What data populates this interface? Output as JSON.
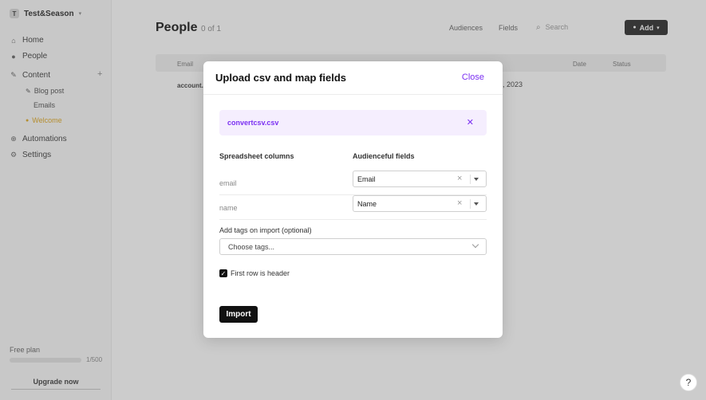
{
  "sidebar": {
    "workspace": {
      "badge": "T",
      "name": "Test&Season"
    },
    "items": [
      {
        "label": "Home",
        "icon": "home-icon"
      },
      {
        "label": "People",
        "icon": "person-icon"
      },
      {
        "label": "Content",
        "icon": "content-icon"
      },
      {
        "label": "Automations",
        "icon": "automation-icon"
      },
      {
        "label": "Settings",
        "icon": "gear-icon"
      }
    ],
    "content_sub": [
      "Blog post",
      "Emails",
      "Welcome"
    ],
    "add_glyph": "+",
    "plan_label": "Free plan",
    "plan_count": "1/500",
    "upgrade_label": "Upgrade now"
  },
  "main": {
    "title": "People",
    "count": "0 of 1",
    "links": [
      "Audiences",
      "Fields"
    ],
    "search_placeholder": "Search",
    "add_label": "Add",
    "table_headers": [
      "Email",
      "Date",
      "Status"
    ],
    "row_email": "account...",
    "row_date": ", 2023"
  },
  "modal": {
    "title": "Upload csv and map fields",
    "close_label": "Close",
    "file_name": "convertcsv.csv",
    "remove_glyph": "✕",
    "col_spreadsheet": "Spreadsheet columns",
    "col_fields": "Audienceful fields",
    "rows": [
      {
        "column": "email",
        "field": "Email"
      },
      {
        "column": "name",
        "field": "Name"
      }
    ],
    "clear_glyph": "×",
    "tags_label": "Add tags on import (optional)",
    "tags_placeholder": "Choose tags...",
    "checkbox_glyph": "✓",
    "checkbox_label": "First row is header",
    "import_label": "Import"
  },
  "help_label": "?",
  "colors": {
    "accent": "#7b2ff2",
    "file_bg": "#f5eefe",
    "primary_button": "#111111"
  }
}
